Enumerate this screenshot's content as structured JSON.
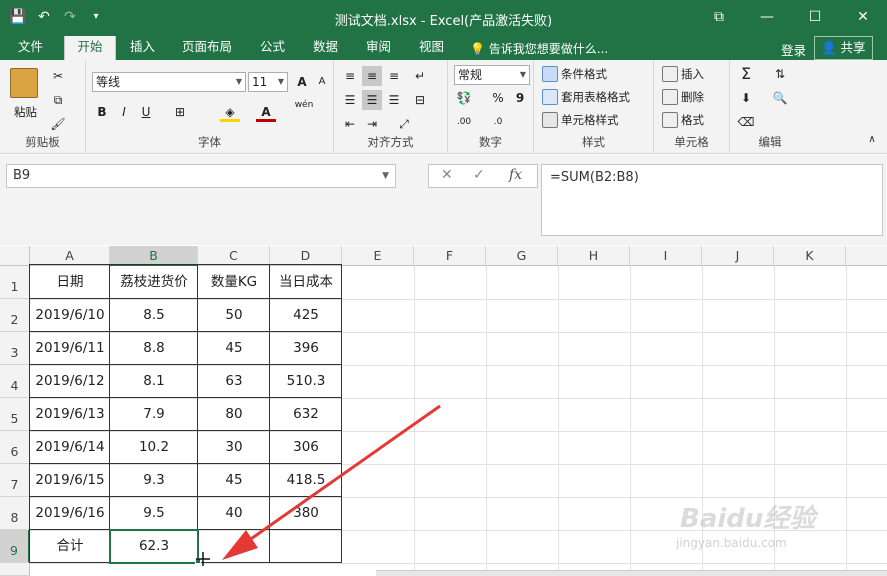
{
  "window": {
    "title": "测试文档.xlsx - Excel(产品激活失败)",
    "buttons": [
      "⧉",
      "—",
      "☐",
      "✕"
    ]
  },
  "tabs": [
    {
      "label": "文件"
    },
    {
      "label": "开始"
    },
    {
      "label": "插入"
    },
    {
      "label": "页面布局"
    },
    {
      "label": "公式"
    },
    {
      "label": "数据"
    },
    {
      "label": "审阅"
    },
    {
      "label": "视图"
    }
  ],
  "tellme": "告诉我您想要做什么...",
  "login": "登录",
  "share": "共享",
  "ribbon": {
    "clipboard": {
      "label": "剪贴板",
      "paste": "粘贴"
    },
    "font": {
      "label": "字体",
      "name": "等线",
      "size": "11",
      "bold": "B",
      "italic": "I",
      "underline": "U",
      "grow": "A",
      "shrink": "A",
      "wen": "wén"
    },
    "align": {
      "label": "对齐方式"
    },
    "number": {
      "label": "数字",
      "format": "常规",
      "percent": "%",
      "comma": "9"
    },
    "styles": {
      "label": "样式",
      "cond": "条件格式",
      "table": "套用表格格式",
      "cell": "单元格样式"
    },
    "cells": {
      "label": "单元格",
      "insert": "插入",
      "delete": "删除",
      "format": "格式"
    },
    "edit": {
      "label": "编辑",
      "sigma": "Σ"
    }
  },
  "formula": {
    "namebox": "B9",
    "content": "=SUM(B2:B8)",
    "fx": "fx"
  },
  "columns": [
    "A",
    "B",
    "C",
    "D",
    "E",
    "F",
    "G",
    "H",
    "I",
    "J",
    "K"
  ],
  "rows": [
    "1",
    "2",
    "3",
    "4",
    "5",
    "6",
    "7",
    "8",
    "9"
  ],
  "table": {
    "headers": [
      "日期",
      "荔枝进货价",
      "数量KG",
      "当日成本"
    ],
    "data": [
      [
        "2019/6/10",
        "8.5",
        "50",
        "425"
      ],
      [
        "2019/6/11",
        "8.8",
        "45",
        "396"
      ],
      [
        "2019/6/12",
        "8.1",
        "63",
        "510.3"
      ],
      [
        "2019/6/13",
        "7.9",
        "80",
        "632"
      ],
      [
        "2019/6/14",
        "10.2",
        "30",
        "306"
      ],
      [
        "2019/6/15",
        "9.3",
        "45",
        "418.5"
      ],
      [
        "2019/6/16",
        "9.5",
        "40",
        "380"
      ]
    ],
    "total": [
      "合计",
      "62.3",
      "",
      ""
    ]
  },
  "watermark": {
    "brand": "Baidu经验",
    "url": "jingyan.baidu.com"
  },
  "colors": {
    "accent": "#217346",
    "arrow": "#e53935"
  }
}
